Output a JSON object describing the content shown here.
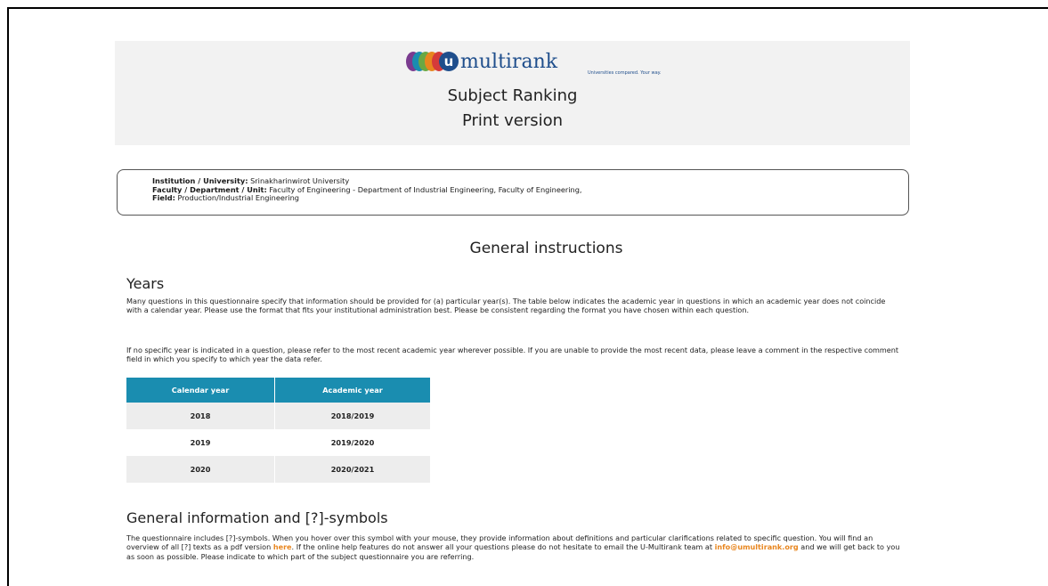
{
  "header": {
    "logo_letter": "u",
    "logo_text": "multirank",
    "tagline": "Universities compared. Your way.",
    "title": "Subject Ranking",
    "subtitle": "Print version"
  },
  "info": {
    "institution_label": "Institution / University:",
    "institution_value": " Srinakharinwirot University",
    "faculty_label": "Faculty / Department / Unit:",
    "faculty_value": " Faculty of Engineering - Department of Industrial Engineering, Faculty of Engineering,",
    "field_label": "Field:",
    "field_value": " Production/Industrial Engineering"
  },
  "general_instructions": {
    "title": "General instructions",
    "years_heading": "Years",
    "years_p1": "Many questions in this questionnaire specify that information should be provided for (a) particular year(s). The table below indicates the academic year in questions in which an academic year does not coincide with a calendar year. Please use the format that fits your institutional administration best. Please be consistent regarding the format you have chosen within each question.",
    "years_p2": "If no specific year is indicated in a question, please refer to the most recent academic year wherever possible. If you are unable to provide the most recent data, please leave a comment in the respective comment field in which you specify to which year the data refer."
  },
  "year_table": {
    "headers": [
      "Calendar year",
      "Academic year"
    ],
    "rows": [
      [
        "2018",
        "2018/2019"
      ],
      [
        "2019",
        "2019/2020"
      ],
      [
        "2020",
        "2020/2021"
      ]
    ]
  },
  "general_info": {
    "heading": "General information and [?]-symbols",
    "text_a": "The questionnaire includes [?]-symbols. When you hover over this symbol with your mouse, they provide information about definitions and particular clarifications related to specific question. You will find an overview of all [?] texts as a pdf version ",
    "link_here": "here",
    "text_b": ". If the online help features do not answer all your questions please do not hesitate to email the U-Multirank team at ",
    "email": "info@umultirank.org",
    "text_c": " and we will get back to you as soon as possible. Please indicate to which part of the subject questionnaire you are referring."
  },
  "colors": {
    "table_header": "#1a8db0",
    "link": "#e8861f",
    "logo_blue": "#1f4e8c"
  }
}
